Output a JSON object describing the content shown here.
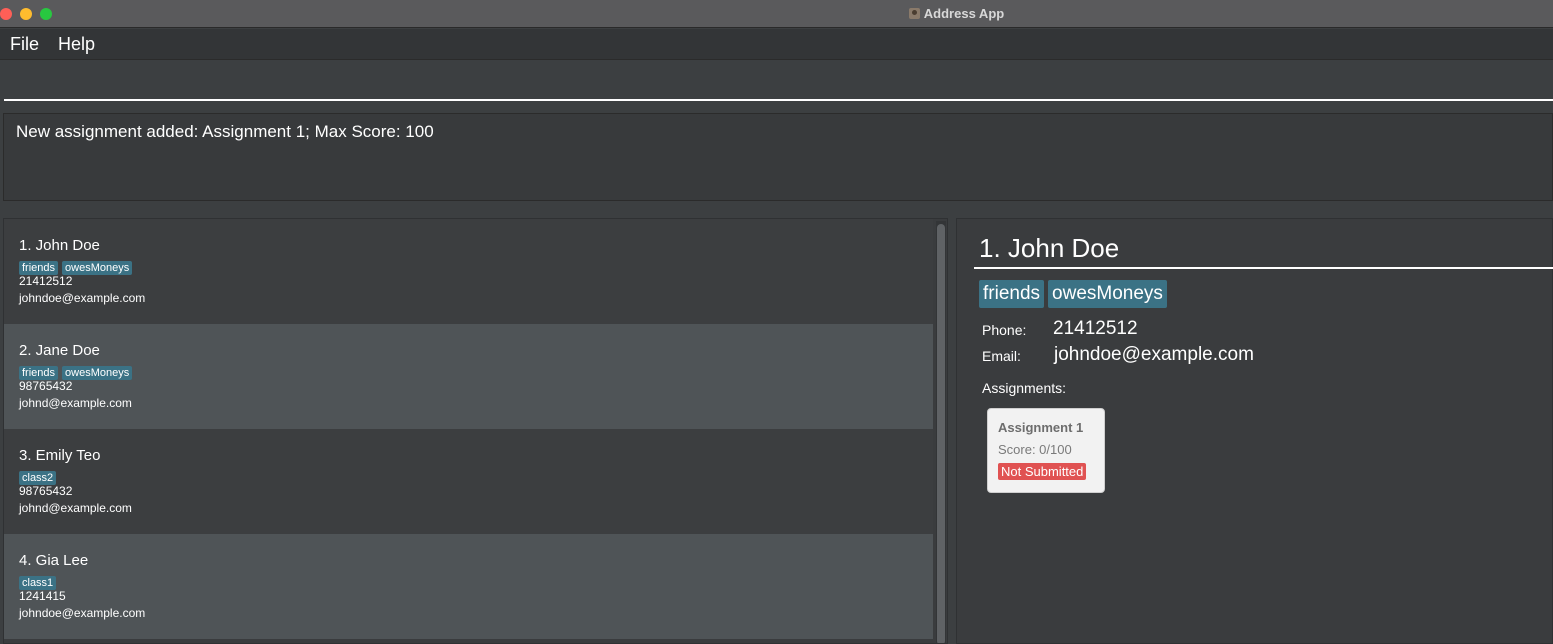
{
  "window": {
    "title": "Address App"
  },
  "menu": {
    "file": "File",
    "help": "Help"
  },
  "command": {
    "value": ""
  },
  "result": {
    "text": "New assignment added: Assignment 1; Max Score: 100"
  },
  "persons": [
    {
      "name": "1. John Doe",
      "tags": [
        "friends",
        "owesMoneys"
      ],
      "phone": "21412512",
      "email": "johndoe@example.com"
    },
    {
      "name": "2. Jane Doe",
      "tags": [
        "friends",
        "owesMoneys"
      ],
      "phone": "98765432",
      "email": "johnd@example.com"
    },
    {
      "name": "3. Emily Teo",
      "tags": [
        "class2"
      ],
      "phone": "98765432",
      "email": "johnd@example.com"
    },
    {
      "name": "4. Gia Lee",
      "tags": [
        "class1"
      ],
      "phone": "1241415",
      "email": "johndoe@example.com"
    }
  ],
  "detail": {
    "name": "1. John Doe",
    "tags": [
      "friends",
      "owesMoneys"
    ],
    "phone_label": "Phone:",
    "phone": "21412512",
    "email_label": "Email:",
    "email": "johndoe@example.com",
    "assignments_label": "Assignments:",
    "assignments": [
      {
        "title": "Assignment 1",
        "score": "Score: 0/100",
        "status": "Not Submitted"
      }
    ]
  }
}
